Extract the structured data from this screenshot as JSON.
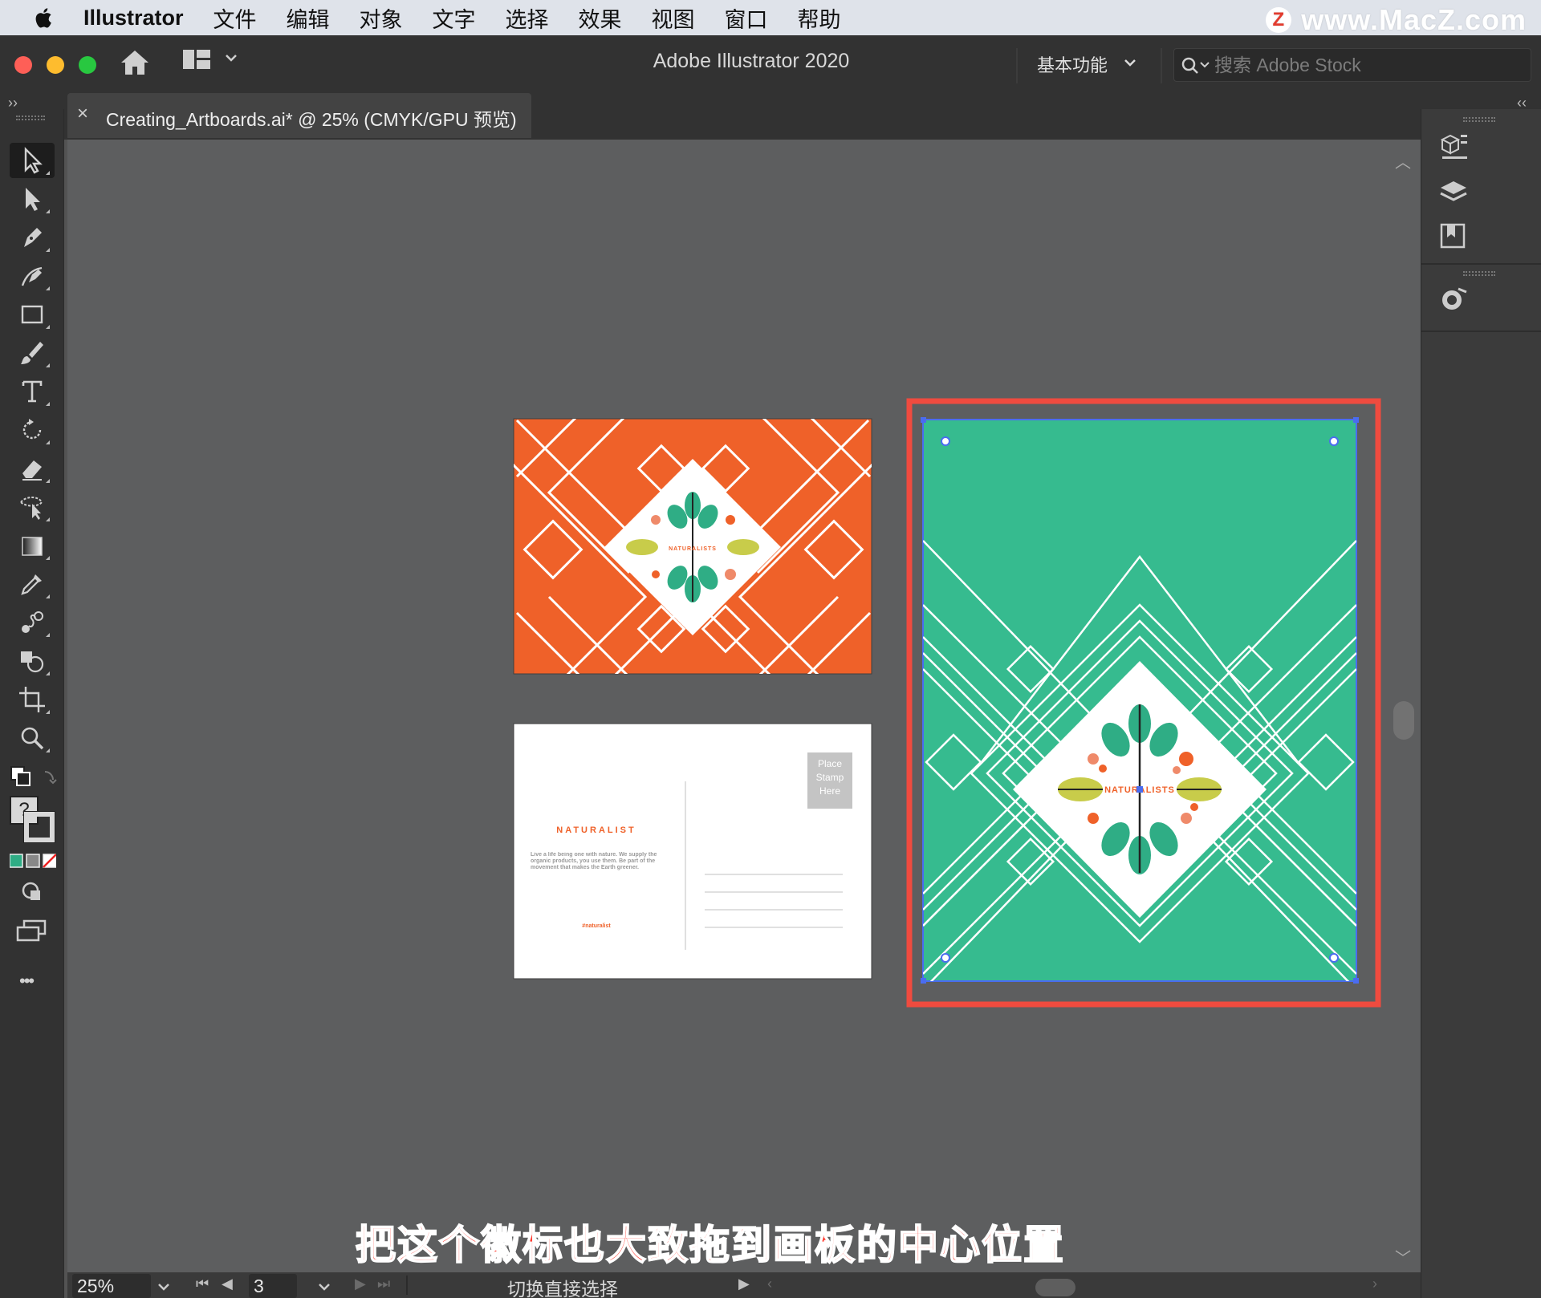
{
  "menubar": {
    "app_name": "Illustrator",
    "items": [
      "文件",
      "编辑",
      "对象",
      "文字",
      "选择",
      "效果",
      "视图",
      "窗口",
      "帮助"
    ],
    "watermark": "www.MacZ.com",
    "watermark_logo": "Z"
  },
  "titlebar": {
    "title": "Adobe Illustrator 2020",
    "workspace": "基本功能",
    "search_placeholder": "搜索 Adobe Stock"
  },
  "document_tab": {
    "close": "×",
    "name": "Creating_Artboards.ai* @ 25% (CMYK/GPU 预览)"
  },
  "tools": [
    {
      "name": "selection-tool-icon",
      "active": true
    },
    {
      "name": "direct-selection-tool-icon"
    },
    {
      "name": "pen-tool-icon"
    },
    {
      "name": "curvature-tool-icon"
    },
    {
      "name": "rectangle-tool-icon"
    },
    {
      "name": "paintbrush-tool-icon"
    },
    {
      "name": "type-tool-icon"
    },
    {
      "name": "rotate-tool-icon"
    },
    {
      "name": "eraser-tool-icon"
    },
    {
      "name": "puppet-warp-tool-icon"
    },
    {
      "name": "gradient-tool-icon"
    },
    {
      "name": "eyedropper-tool-icon"
    },
    {
      "name": "blend-tool-icon"
    },
    {
      "name": "shape-builder-tool-icon"
    },
    {
      "name": "artboard-tool-icon"
    },
    {
      "name": "zoom-tool-icon"
    }
  ],
  "fill_stroke": {
    "fill_label": "?"
  },
  "more_tools": "•••",
  "artboards": {
    "front": {
      "bg": "#ef6129",
      "logo_text": "NATURALISTS"
    },
    "back": {
      "brand": "NATURALIST",
      "body": "Live a life being one with nature. We supply the organic products, you use them. Be part of the movement that makes the Earth greener.",
      "hashtag": "#naturalist",
      "stamp_lines": [
        "Place",
        "Stamp",
        "Here"
      ]
    },
    "poster": {
      "bg": "#36bb8f",
      "logo_text": "NATURALISTS",
      "highlight": "#ef4b3f"
    }
  },
  "colors": {
    "orange": "#ef6129",
    "teal": "#36bb8f",
    "leaf_green": "#2fad85",
    "lime": "#c8cc4a",
    "red_accent": "#ef4b3f"
  },
  "status": {
    "zoom": "25%",
    "page": "3",
    "message": "切换直接选择"
  },
  "subtitle": "把这个徽标也大致拖到画板的中心位置"
}
